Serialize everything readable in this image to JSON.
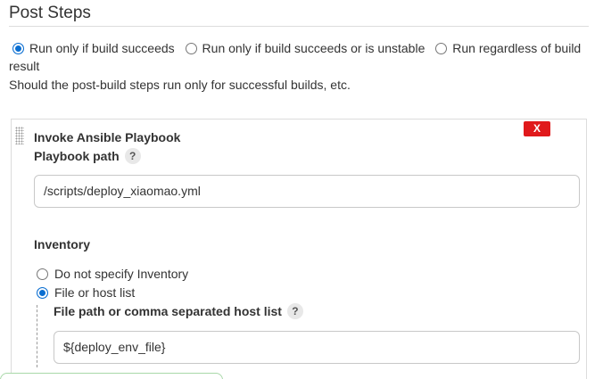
{
  "post_steps": {
    "title": "Post Steps",
    "options": [
      {
        "label": "Run only if build succeeds",
        "checked": true
      },
      {
        "label": "Run only if build succeeds or is unstable",
        "checked": false
      },
      {
        "label": "Run regardless of build result",
        "checked": false
      }
    ],
    "help": "Should the post-build steps run only for successful builds, etc."
  },
  "step": {
    "title": "Invoke Ansible Playbook",
    "delete_label": "X",
    "playbook_label": "Playbook path",
    "playbook_value": "/scripts/deploy_xiaomao.yml",
    "help_glyph": "?",
    "inventory_label": "Inventory",
    "inventory_options": [
      {
        "label": "Do not specify Inventory",
        "checked": false
      },
      {
        "label": "File or host list",
        "checked": true
      }
    ],
    "hostlist_label": "File path or comma separated host list",
    "hostlist_value": "${deploy_env_file}"
  },
  "colors": {
    "accent": "#0a6ed1",
    "delete": "#e0191b"
  }
}
